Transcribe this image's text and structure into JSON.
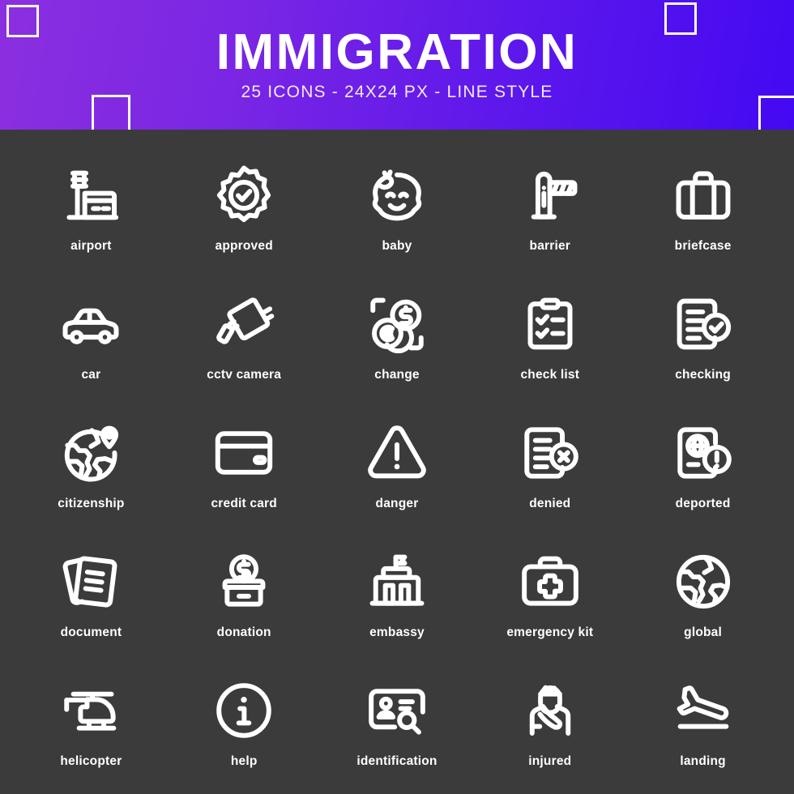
{
  "header": {
    "title": "IMMIGRATION",
    "subtitle": "25 ICONS - 24X24 PX - LINE STYLE",
    "gradient_from": "#8b2fe0",
    "gradient_to": "#4409f2",
    "deco_square_color": "#ffffff"
  },
  "theme": {
    "background": "#3b3b3b",
    "icon_stroke": "#ffffff",
    "label_color": "#ffffff"
  },
  "icons": [
    {
      "name": "airport-icon",
      "label": "airport"
    },
    {
      "name": "approved-icon",
      "label": "approved"
    },
    {
      "name": "baby-icon",
      "label": "baby"
    },
    {
      "name": "barrier-icon",
      "label": "barrier"
    },
    {
      "name": "briefcase-icon",
      "label": "briefcase"
    },
    {
      "name": "car-icon",
      "label": "car"
    },
    {
      "name": "cctv-camera-icon",
      "label": "cctv camera"
    },
    {
      "name": "change-icon",
      "label": "change"
    },
    {
      "name": "check-list-icon",
      "label": "check list"
    },
    {
      "name": "checking-icon",
      "label": "checking"
    },
    {
      "name": "citizenship-icon",
      "label": "citizenship"
    },
    {
      "name": "credit-card-icon",
      "label": "credit card"
    },
    {
      "name": "danger-icon",
      "label": "danger"
    },
    {
      "name": "denied-icon",
      "label": "denied"
    },
    {
      "name": "deported-icon",
      "label": "deported"
    },
    {
      "name": "document-icon",
      "label": "document"
    },
    {
      "name": "donation-icon",
      "label": "donation"
    },
    {
      "name": "embassy-icon",
      "label": "embassy"
    },
    {
      "name": "emergency-kit-icon",
      "label": "emergency kit"
    },
    {
      "name": "global-icon",
      "label": "global"
    },
    {
      "name": "helicopter-icon",
      "label": "helicopter"
    },
    {
      "name": "help-icon",
      "label": "help"
    },
    {
      "name": "identification-icon",
      "label": "identification"
    },
    {
      "name": "injured-icon",
      "label": "injured"
    },
    {
      "name": "landing-icon",
      "label": "landing"
    }
  ]
}
